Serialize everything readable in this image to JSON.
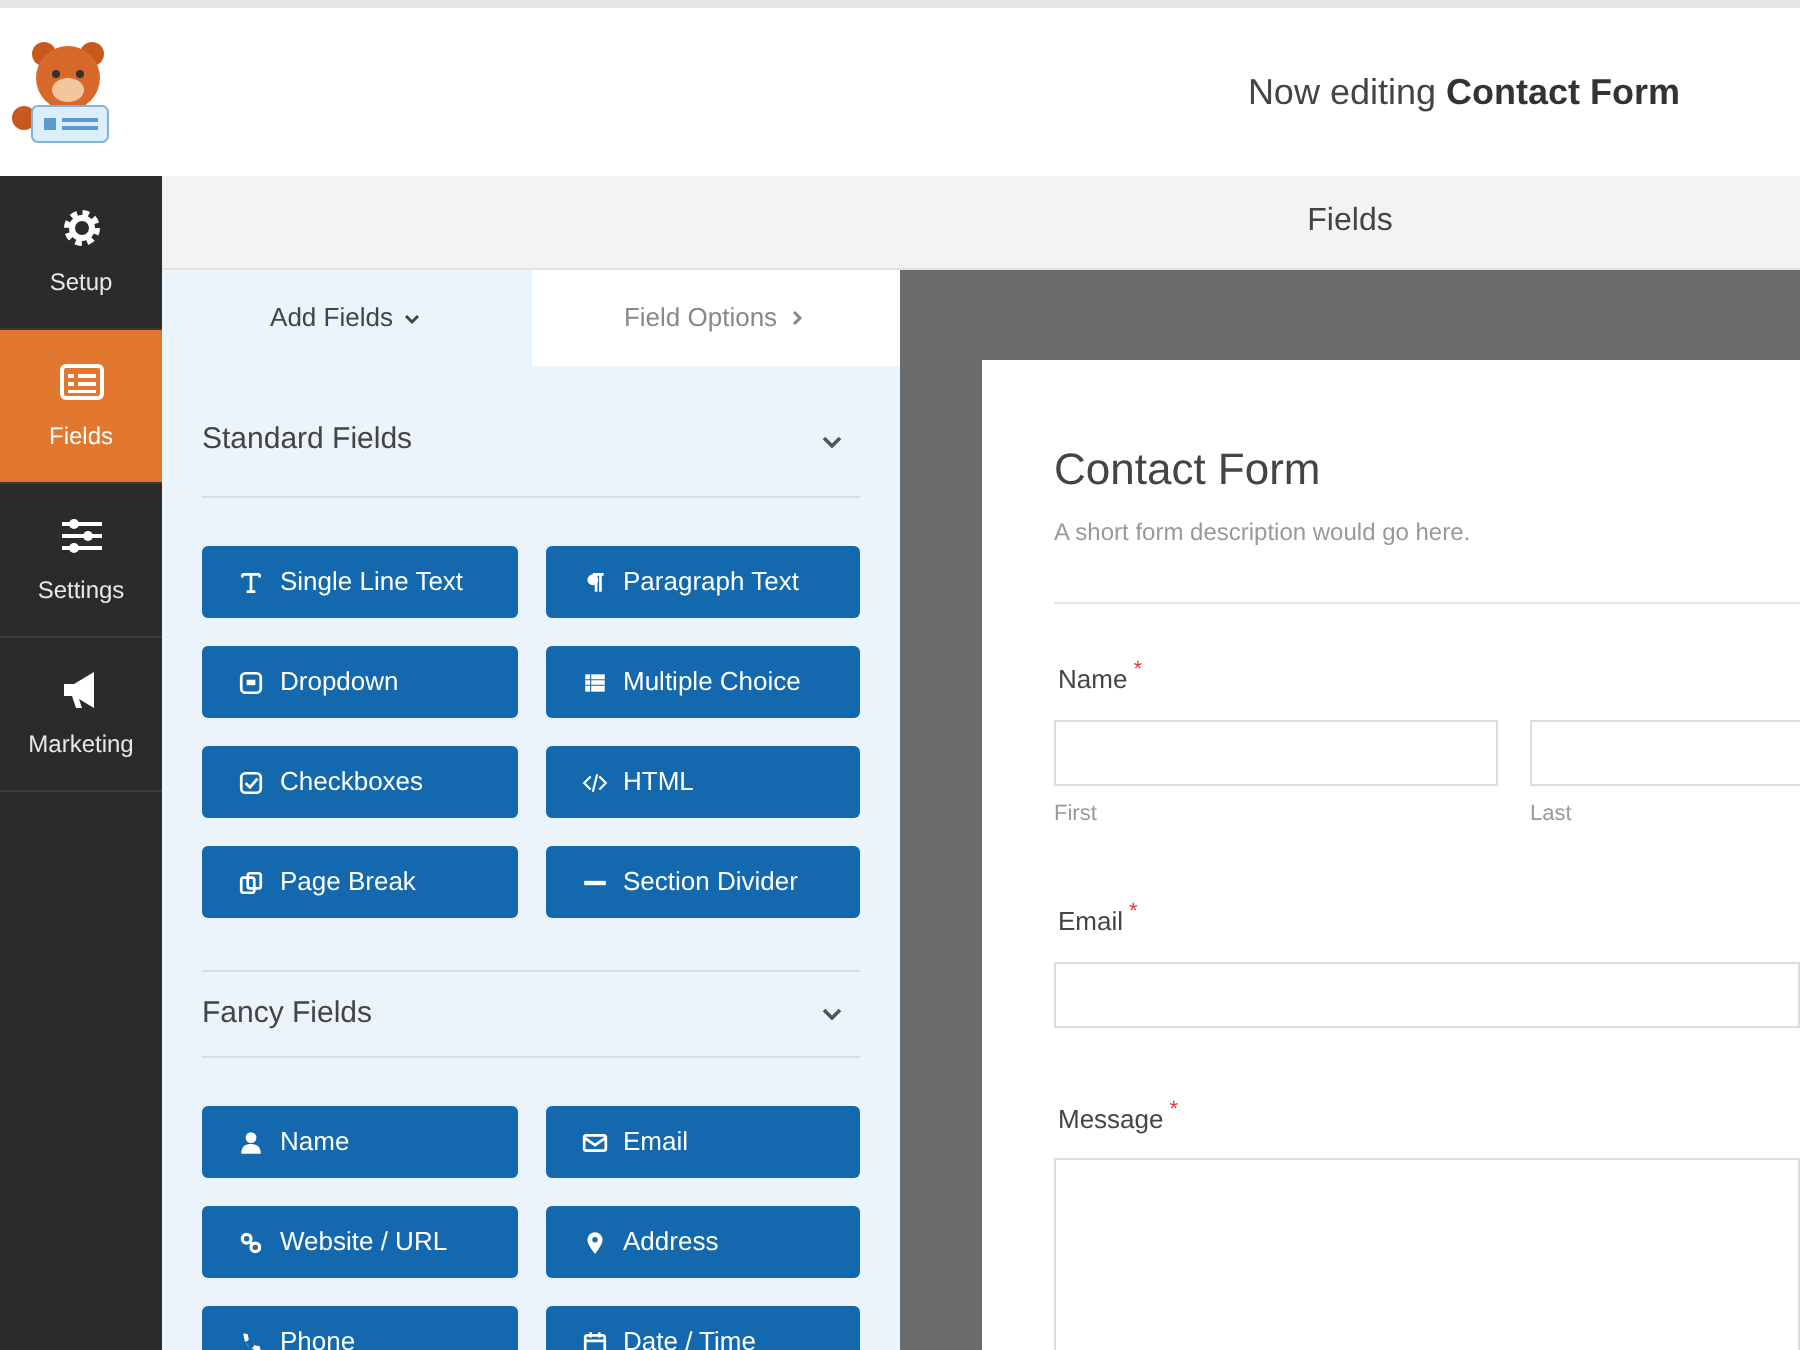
{
  "header": {
    "prefix": "Now editing",
    "form_name": "Contact Form"
  },
  "sidebar": {
    "items": [
      {
        "label": "Setup",
        "kind": "gear",
        "selected": false
      },
      {
        "label": "Fields",
        "kind": "list",
        "selected": true
      },
      {
        "label": "Settings",
        "kind": "sliders",
        "selected": false
      },
      {
        "label": "Marketing",
        "kind": "megaphone",
        "selected": false
      }
    ]
  },
  "top_bar": {
    "title": "Fields"
  },
  "panel_tabs": [
    {
      "label": "Add Fields",
      "selected": true
    },
    {
      "label": "Field Options",
      "selected": false
    }
  ],
  "sections": [
    {
      "title": "Standard Fields",
      "buttons": [
        {
          "label": "Single Line Text",
          "kind": "text"
        },
        {
          "label": "Paragraph Text",
          "kind": "paragraph"
        },
        {
          "label": "Dropdown",
          "kind": "dropdown"
        },
        {
          "label": "Multiple Choice",
          "kind": "choice"
        },
        {
          "label": "Checkboxes",
          "kind": "checkbox"
        },
        {
          "label": "HTML",
          "kind": "code"
        },
        {
          "label": "Page Break",
          "kind": "pagebreak"
        },
        {
          "label": "Section Divider",
          "kind": "divider"
        }
      ]
    },
    {
      "title": "Fancy Fields",
      "buttons": [
        {
          "label": "Name",
          "kind": "person"
        },
        {
          "label": "Email",
          "kind": "envelope"
        },
        {
          "label": "Website / URL",
          "kind": "link"
        },
        {
          "label": "Address",
          "kind": "pin"
        },
        {
          "label": "Phone",
          "kind": "phone"
        },
        {
          "label": "Date / Time",
          "kind": "calendar"
        }
      ]
    }
  ],
  "form": {
    "title": "Contact Form",
    "description": "A short form description would go here.",
    "fields": [
      {
        "label": "Name",
        "required_mark": "*",
        "kind": "name",
        "sublabels": [
          "First",
          "Last"
        ]
      },
      {
        "label": "Email",
        "required_mark": "*",
        "kind": "single"
      },
      {
        "label": "Message",
        "required_mark": "*",
        "kind": "textarea"
      }
    ]
  }
}
